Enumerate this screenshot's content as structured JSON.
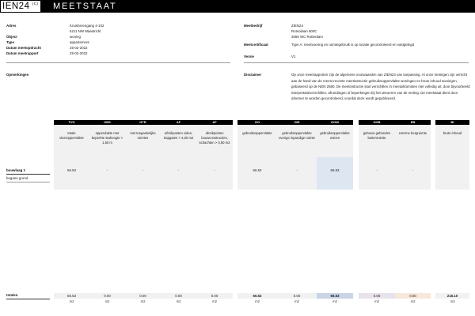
{
  "header": {
    "logo_text": "IEN24",
    "logo_mark": "(C)",
    "doc_title": "MEETSTAAT"
  },
  "info_left": [
    {
      "label": "Adres",
      "lines": [
        "Kruisherengang 4-102",
        "6211 NW Maastricht"
      ]
    },
    {
      "label": "Object",
      "lines": [
        "woning"
      ]
    },
    {
      "label": "Type",
      "lines": [
        "appartement"
      ]
    },
    {
      "label": "Datum meetopdracht",
      "lines": [
        "25-02-2022"
      ]
    },
    {
      "label": "Datum meetrapport",
      "lines": [
        "25-02-2022"
      ]
    }
  ],
  "info_right": [
    {
      "label": "Meetbedrijf",
      "lines": [
        "ZIEN24",
        "Rotsoilaan 600C",
        "3065 WC Rotterdam"
      ]
    },
    {
      "label": "Meetcertificaat",
      "lines": [
        "Type A: meetvoering en ruimtegebruik is op locatie gecontroleerd en vastgelegd"
      ]
    },
    {
      "label": "Versie",
      "lines": [
        "V1"
      ]
    }
  ],
  "remarks": {
    "label": "Opmerkingen",
    "text": ""
  },
  "disclaimer": {
    "label": "Disclaimer",
    "text": "Op onze meetrapporten zijn de algemene voorwaarden van ZIEN24 van toepassing. Al onze metingen zijn verricht aan de hand van de meest recente meetinstructie gebruiksoppervlakte woningen en bruto inhoud woningen, gebaseerd op de NEN 2580. De meetinstructie stuit verschillen in meetuitkomsten niet volledig uit, door bijvoorbeeld interpretatieverschillen, afrondingen of beperkingen bij het uitvoeren van de meting. De meetstaat dient door afnemer te worden gecontroleerd, voordat deze wordt gepubliceerd."
  },
  "columns": [
    {
      "code": "TVO",
      "desc": "totale vloeroppervlakte"
    },
    {
      "code": "OBS",
      "desc": "oppervlakte met beperkte stahoogte < 1,50 m"
    },
    {
      "code": "HTR",
      "desc": "niet toegankelijke ruimtes"
    },
    {
      "code": "AF",
      "desc": "afreikposten vides, trapgaten > 4,00 m2"
    },
    {
      "code": "AF",
      "desc": "afreikposten bouwconstructies, schachten > 0,50 m2"
    },
    {
      "code": "GO",
      "desc": "gebruiksoppervlakte"
    },
    {
      "code": "OIR",
      "desc": "gebruiksoppervlakte overige inpandige ruimte"
    },
    {
      "code": "GOW",
      "desc": "gebruiksoppervlakte wonen"
    },
    {
      "code": "GGB",
      "desc": "gebouw gebonden buitenruimte"
    },
    {
      "code": "EB",
      "desc": "externe bergruimte"
    },
    {
      "code": "BI",
      "desc": "bruto inhoud"
    }
  ],
  "rows": [
    {
      "label": "bouwlaag 1",
      "sublabel": "begane grond",
      "values": [
        "66.53",
        "-",
        "-",
        "-",
        "-",
        "66.53",
        "-",
        "66.53",
        "-",
        "-",
        ""
      ]
    }
  ],
  "totals": {
    "label": "totalen",
    "values": [
      "66.53",
      "0.00",
      "0.00",
      "0.00",
      "0.00",
      "66.53",
      "0.00",
      "66.53",
      "0.00",
      "0.00",
      "218.10"
    ]
  },
  "units": [
    "m2",
    "m2",
    "m2",
    "m2",
    "m2",
    "m2",
    "m2",
    "m2",
    "m2",
    "m2",
    "m3"
  ],
  "colors": {
    "header_bg": "#000000",
    "column_header_bg": "#000000",
    "gow_highlight": "#dde6f1",
    "ggb_total": "#e7e2ec",
    "eb_total": "#f7e8dc",
    "gow_total": "#c9d5e6"
  }
}
